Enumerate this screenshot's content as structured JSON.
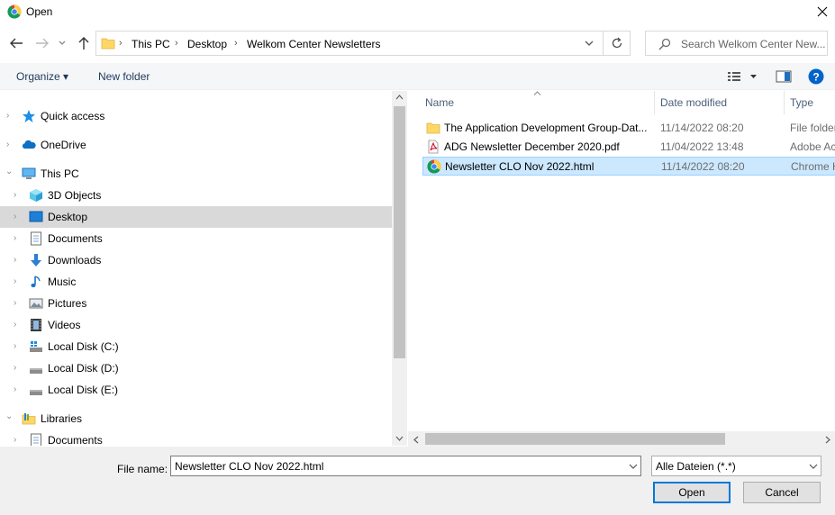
{
  "window": {
    "title": "Open",
    "close_icon": "close-icon",
    "app_icon": "chrome-icon"
  },
  "nav": {
    "back_icon": "arrow-left-icon",
    "forward_icon": "arrow-right-icon",
    "recent_icon": "chevron-down-icon",
    "up_icon": "arrow-up-icon"
  },
  "address": {
    "segments": [
      "This PC",
      "Desktop",
      "Welkom Center Newsletters"
    ],
    "separator": "›"
  },
  "search": {
    "placeholder": "Search Welkom Center New..."
  },
  "toolbar": {
    "organize": "Organize ▾",
    "new_folder": "New folder"
  },
  "navpane": {
    "items": [
      {
        "label": "Quick access",
        "icon": "star-icon"
      },
      {
        "label": "OneDrive",
        "icon": "cloud-icon"
      },
      {
        "label": "This PC",
        "icon": "computer-icon"
      },
      {
        "label": "3D Objects",
        "icon": "cube-icon"
      },
      {
        "label": "Desktop",
        "icon": "desktop-icon"
      },
      {
        "label": "Documents",
        "icon": "document-icon"
      },
      {
        "label": "Downloads",
        "icon": "download-icon"
      },
      {
        "label": "Music",
        "icon": "music-icon"
      },
      {
        "label": "Pictures",
        "icon": "picture-icon"
      },
      {
        "label": "Videos",
        "icon": "video-icon"
      },
      {
        "label": "Local Disk (C:)",
        "icon": "drive-icon"
      },
      {
        "label": "Local Disk (D:)",
        "icon": "drive-icon"
      },
      {
        "label": "Local Disk (E:)",
        "icon": "drive-icon"
      },
      {
        "label": "Libraries",
        "icon": "library-icon"
      },
      {
        "label": "Documents",
        "icon": "document-icon"
      }
    ]
  },
  "filelist": {
    "columns": {
      "name": "Name",
      "date": "Date modified",
      "type": "Type"
    },
    "rows": [
      {
        "name": "The Application Development Group-Dat...",
        "date": "11/14/2022 08:20",
        "type": "File folder",
        "icon": "folder-icon"
      },
      {
        "name": "ADG Newsletter December 2020.pdf",
        "date": "11/04/2022 13:48",
        "type": "Adobe Ac",
        "icon": "pdf-icon"
      },
      {
        "name": "Newsletter CLO Nov 2022.html",
        "date": "11/14/2022 08:20",
        "type": "Chrome H",
        "icon": "chrome-icon"
      }
    ]
  },
  "footer": {
    "file_name_label": "File name:",
    "file_name_value": "Newsletter CLO Nov 2022.html",
    "file_type_value": "Alle Dateien (*.*)",
    "open_label": "Open",
    "cancel_label": "Cancel"
  },
  "colors": {
    "accent": "#0078d7",
    "selection": "#cce8ff",
    "selection_border": "#99d1ff"
  }
}
